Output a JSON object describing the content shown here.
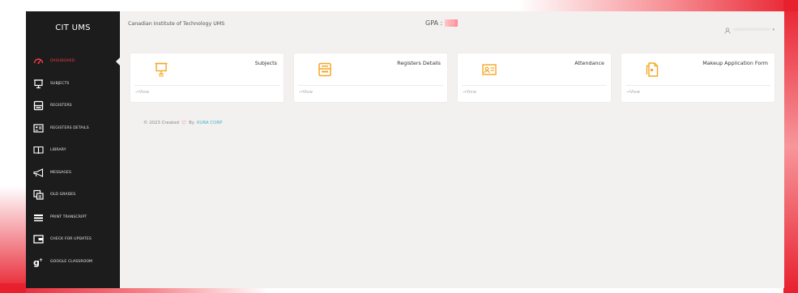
{
  "brand": "CIT UMS",
  "topbar": {
    "site_name": "Canadian Institute of Technology UMS",
    "gpa_label": "GPA :",
    "gpa_value": "3.8",
    "username": "••••••••••••••"
  },
  "sidebar": {
    "items": [
      {
        "label": "DASHBOARD",
        "icon": "dashboard-icon"
      },
      {
        "label": "SUBJECTS",
        "icon": "subjects-icon"
      },
      {
        "label": "REGISTERS",
        "icon": "registers-icon"
      },
      {
        "label": "REGISTERS DETAILS",
        "icon": "registers-details-icon"
      },
      {
        "label": "LIBRARY",
        "icon": "book-icon"
      },
      {
        "label": "MESSAGES",
        "icon": "megaphone-icon"
      },
      {
        "label": "OLD GRADES",
        "icon": "old-grades-icon"
      },
      {
        "label": "PRINT TRANSCRIPT",
        "icon": "print-icon"
      },
      {
        "label": "CHECK FOR UPDATES",
        "icon": "wallet-icon"
      },
      {
        "label": "GOOGLE CLASSROOM",
        "icon": "google-plus-icon"
      }
    ]
  },
  "cards": [
    {
      "title": "Subjects",
      "view": "→View",
      "icon": "easel-icon"
    },
    {
      "title": "Registers Details",
      "view": "→View",
      "icon": "server-icon"
    },
    {
      "title": "Attendance",
      "view": "→View",
      "icon": "id-card-icon"
    },
    {
      "title": "Makeup Application Form",
      "view": "→View",
      "icon": "document-icon"
    }
  ],
  "footer": {
    "text": "© 2023 Created",
    "by": "By",
    "company": "KURA CORP"
  },
  "colors": {
    "accent": "#e8202e",
    "sidebar_bg": "#1c1c1c",
    "icon_orange": "#f5a623",
    "link_blue": "#4fb0d0"
  }
}
